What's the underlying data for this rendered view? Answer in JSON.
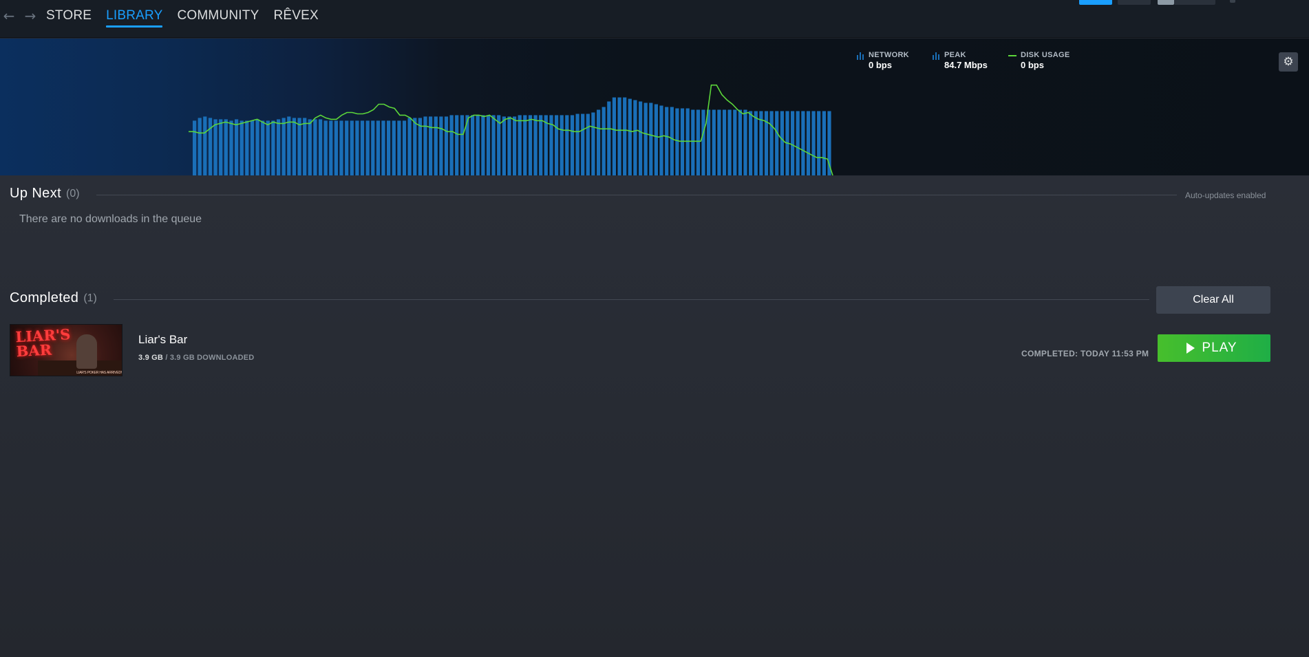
{
  "nav": {
    "back_icon": "arrow-left-icon",
    "forward_icon": "arrow-right-icon",
    "tabs": [
      {
        "label": "STORE",
        "active": false
      },
      {
        "label": "LIBRARY",
        "active": true
      },
      {
        "label": "COMMUNITY",
        "active": false
      },
      {
        "label": "RÊVEX",
        "active": false
      }
    ]
  },
  "graph": {
    "legend": {
      "network": {
        "label": "NETWORK",
        "value": "0 bps"
      },
      "peak": {
        "label": "PEAK",
        "value": "84.7 Mbps"
      },
      "disk": {
        "label": "DISK USAGE",
        "value": "0 bps"
      }
    },
    "colors": {
      "network": "#1a6fb8",
      "disk": "#5cd63a"
    },
    "chart_data": {
      "type": "bar",
      "series": [
        {
          "name": "NETWORK",
          "values": [
            0.4,
            0.42,
            0.43,
            0.42,
            0.41,
            0.41,
            0.41,
            0.4,
            0.41,
            0.4,
            0.4,
            0.4,
            0.41,
            0.4,
            0.4,
            0.4,
            0.41,
            0.42,
            0.43,
            0.42,
            0.42,
            0.42,
            0.41,
            0.41,
            0.41,
            0.4,
            0.4,
            0.4,
            0.4,
            0.4,
            0.4,
            0.4,
            0.4,
            0.4,
            0.4,
            0.4,
            0.4,
            0.4,
            0.4,
            0.4,
            0.4,
            0.42,
            0.42,
            0.42,
            0.43,
            0.43,
            0.43,
            0.43,
            0.43,
            0.44,
            0.44,
            0.44,
            0.44,
            0.44,
            0.44,
            0.44,
            0.44,
            0.44,
            0.44,
            0.43,
            0.43,
            0.43,
            0.44,
            0.44,
            0.44,
            0.44,
            0.44,
            0.44,
            0.44,
            0.44,
            0.44,
            0.44,
            0.44,
            0.45,
            0.45,
            0.45,
            0.46,
            0.48,
            0.5,
            0.54,
            0.57,
            0.57,
            0.57,
            0.56,
            0.55,
            0.54,
            0.53,
            0.53,
            0.52,
            0.51,
            0.5,
            0.5,
            0.49,
            0.49,
            0.49,
            0.48,
            0.48,
            0.48,
            0.48,
            0.48,
            0.48,
            0.48,
            0.48,
            0.48,
            0.48,
            0.48,
            0.47,
            0.47,
            0.47,
            0.47,
            0.47,
            0.47,
            0.47,
            0.47,
            0.47,
            0.47,
            0.47,
            0.47,
            0.47,
            0.47,
            0.47,
            0.47
          ]
        },
        {
          "name": "DISK USAGE",
          "values": [
            0.32,
            0.32,
            0.31,
            0.31,
            0.34,
            0.37,
            0.38,
            0.39,
            0.38,
            0.37,
            0.38,
            0.39,
            0.4,
            0.41,
            0.39,
            0.37,
            0.39,
            0.38,
            0.38,
            0.39,
            0.39,
            0.37,
            0.38,
            0.38,
            0.42,
            0.44,
            0.42,
            0.41,
            0.41,
            0.44,
            0.46,
            0.46,
            0.45,
            0.45,
            0.46,
            0.48,
            0.52,
            0.52,
            0.5,
            0.49,
            0.44,
            0.44,
            0.42,
            0.38,
            0.36,
            0.36,
            0.35,
            0.35,
            0.34,
            0.32,
            0.32,
            0.3,
            0.3,
            0.42,
            0.44,
            0.44,
            0.43,
            0.44,
            0.41,
            0.38,
            0.41,
            0.42,
            0.4,
            0.4,
            0.4,
            0.41,
            0.4,
            0.4,
            0.38,
            0.37,
            0.34,
            0.33,
            0.33,
            0.32,
            0.32,
            0.34,
            0.36,
            0.35,
            0.34,
            0.34,
            0.34,
            0.33,
            0.33,
            0.33,
            0.32,
            0.33,
            0.31,
            0.3,
            0.29,
            0.28,
            0.29,
            0.28,
            0.26,
            0.25,
            0.25,
            0.25,
            0.25,
            0.25,
            0.38,
            0.66,
            0.66,
            0.59,
            0.55,
            0.52,
            0.48,
            0.45,
            0.46,
            0.43,
            0.41,
            0.4,
            0.38,
            0.34,
            0.28,
            0.24,
            0.23,
            0.21,
            0.19,
            0.17,
            0.15,
            0.13,
            0.13,
            0.12,
            0.0
          ]
        }
      ]
    }
  },
  "settings_icon": "gear-icon",
  "up_next": {
    "title": "Up Next",
    "count": "(0)",
    "auto_updates": "Auto-updates enabled",
    "empty_message": "There are no downloads in the queue"
  },
  "completed": {
    "title": "Completed",
    "count": "(1)",
    "clear_label": "Clear All",
    "items": [
      {
        "name": "Liar's Bar",
        "thumb_title": "LIAR'S BAR",
        "thumb_banner": "LIAR'S POKER HAS ARRIVED!",
        "size_downloaded": "3.9 GB",
        "size_rest": "/ 3.9 GB DOWNLOADED",
        "completed_text": "COMPLETED: TODAY 11:53 PM",
        "play_label": "PLAY",
        "play_color": "#47bf2c"
      }
    ]
  }
}
